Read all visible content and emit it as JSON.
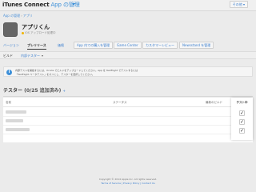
{
  "topbar": {
    "brand": "iTunes Connect",
    "app_label": "App の管理"
  },
  "breadcrumb": [
    "App の管理",
    "アプリ"
  ],
  "app": {
    "name": "アプリくん",
    "subtitle": "iOS アップロード処理中"
  },
  "tabs": [
    {
      "label": "バージョン",
      "active": false,
      "framed": false
    },
    {
      "label": "プレリリース",
      "active": true,
      "framed": false
    },
    {
      "label": "価格",
      "active": false,
      "framed": false
    },
    {
      "label": "App 内での購入を管理",
      "active": false,
      "framed": true
    },
    {
      "label": "Game Center",
      "active": false,
      "framed": true
    },
    {
      "label": "カスタマーレビュー",
      "active": false,
      "framed": true
    },
    {
      "label": "Newsstand を管理",
      "active": false,
      "framed": true
    }
  ],
  "more_label": "その他",
  "subtabs": [
    {
      "label": "ビルド",
      "active": true,
      "dropdown": false
    },
    {
      "label": "内部テスター",
      "active": false,
      "dropdown": true
    }
  ],
  "notice": {
    "icon": "info-icon",
    "line1": "内部テストを開始するには、Xcode でビルドをアップロードしてください。App を TestFlight でテストするには",
    "line2": "「TestFlight ベータテスト」をオンにし、テスターを選択してください。"
  },
  "section": {
    "title": "テスター",
    "count": "(0/25 追加済み)",
    "link": "+"
  },
  "table": {
    "columns": [
      "名前",
      "ステータス",
      "最新のビルド"
    ],
    "rows": 3
  },
  "testing_column": {
    "header": "テスト中",
    "checked": [
      true,
      true,
      true
    ]
  },
  "footer": {
    "line1": "Copyright © 2014 Apple Inc. All rights reserved.",
    "line2": "Terms of Service | Privacy Policy | Contact Us"
  }
}
